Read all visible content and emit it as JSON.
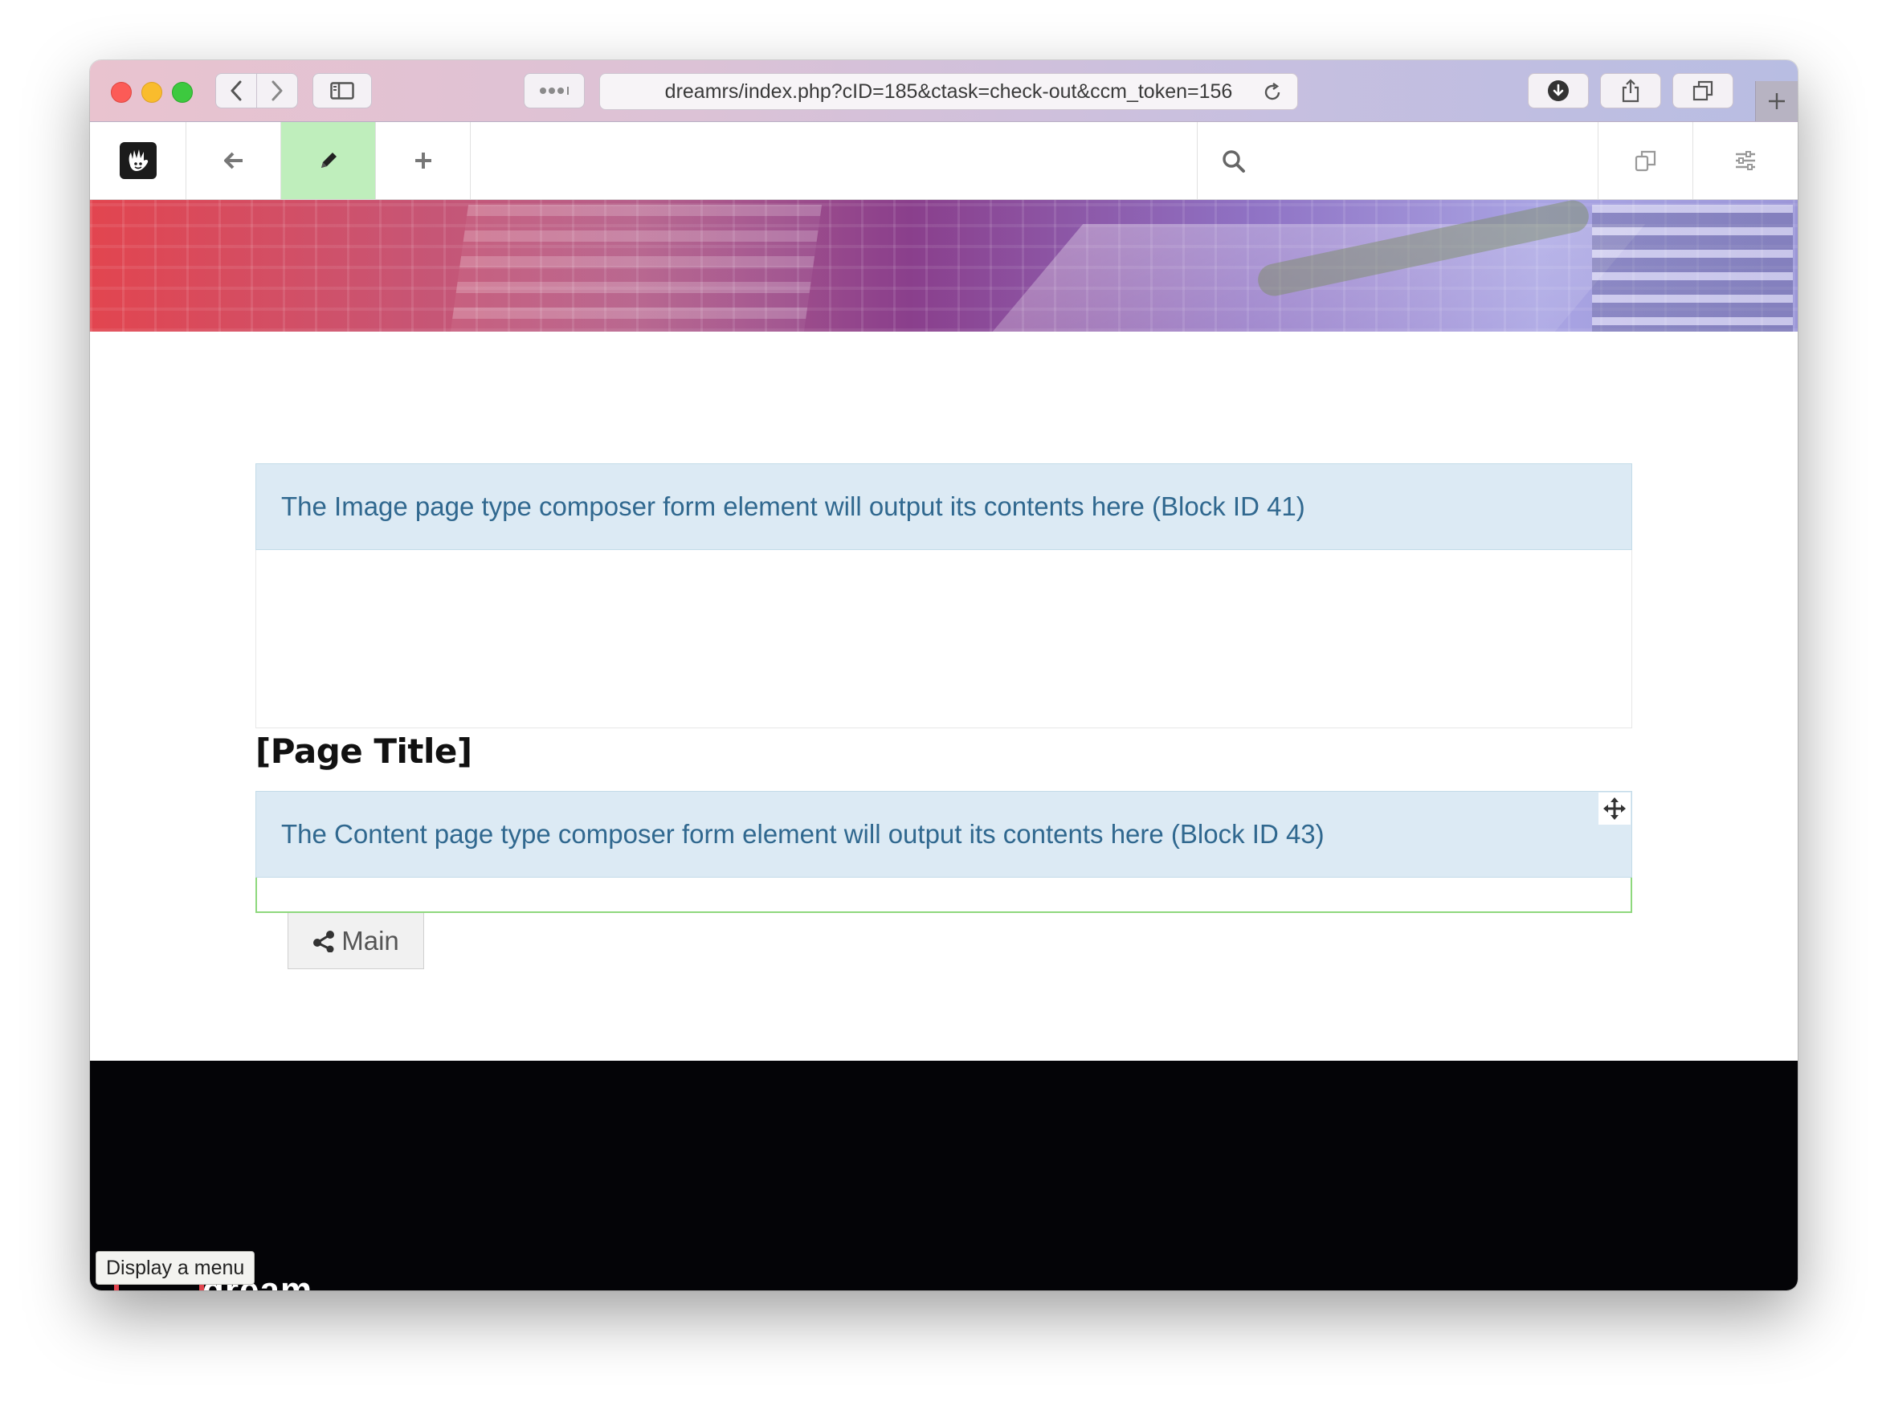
{
  "browser": {
    "url": "dreamrs/index.php?cID=185&ctask=check-out&ccm_token=156",
    "buttons": [
      "back-icon",
      "forward-icon",
      "sidebar-icon",
      "reader-icon",
      "reload-icon",
      "download-icon",
      "share-icon",
      "tabs-icon",
      "new-tab-icon"
    ]
  },
  "toolbar": {
    "items": [
      "concrete5-logo",
      "back-arrow-icon",
      "edit-pencil-icon",
      "add-plus-icon",
      "search-icon",
      "sitemap-icon",
      "settings-sliders-icon"
    ],
    "search_placeholder": "",
    "active_color": "#bfeebc"
  },
  "page": {
    "image_block_note": "The Image page type composer form element will output its contents here (Block ID 41)",
    "title": "[Page Title]",
    "content_block_note": "The Content page type composer form element will output its contents here (Block ID 43)",
    "area_label": "Main"
  },
  "footer": {
    "tooltip": "Display a menu",
    "logo_text": "dream"
  },
  "colors": {
    "note_bg": "#dceaf4",
    "note_text": "#30688f",
    "area_border": "#8ed87d",
    "footer_bg": "#040407"
  }
}
